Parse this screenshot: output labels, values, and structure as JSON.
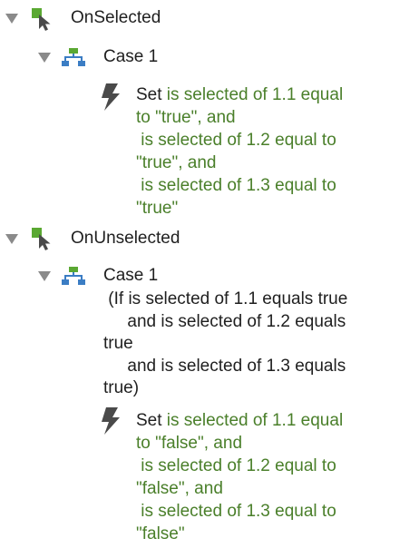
{
  "events": [
    {
      "name": "OnSelected",
      "case": {
        "label": "Case 1",
        "condition_lines": []
      },
      "action": {
        "verb": "Set",
        "lines": [
          " is selected of 1.1 equal",
          "to \"true\", and",
          " is selected of 1.2 equal to",
          "\"true\", and",
          " is selected of 1.3 equal to",
          "\"true\""
        ]
      }
    },
    {
      "name": "OnUnselected",
      "case": {
        "label": "Case 1",
        "condition_lines": [
          " (If is selected of 1.1 equals true",
          "     and is selected of 1.2 equals",
          "true",
          "     and is selected of 1.3 equals",
          "true)"
        ]
      },
      "action": {
        "verb": "Set",
        "lines": [
          " is selected of 1.1 equal",
          "to \"false\", and",
          " is selected of 1.2 equal to",
          "\"false\", and",
          " is selected of 1.3 equal to",
          "\"false\""
        ]
      }
    }
  ],
  "colors": {
    "event_icon": "#5aa832",
    "case_icon_top": "#5aa832",
    "case_icon_bottom": "#3b7dc4",
    "action_text": "#4a7f2a",
    "disclosure": "#8a8a8a"
  },
  "icons": {
    "event": "event-cursor-icon",
    "case": "case-tree-icon",
    "action": "lightning-icon",
    "disclosure": "disclosure-triangle-icon"
  }
}
